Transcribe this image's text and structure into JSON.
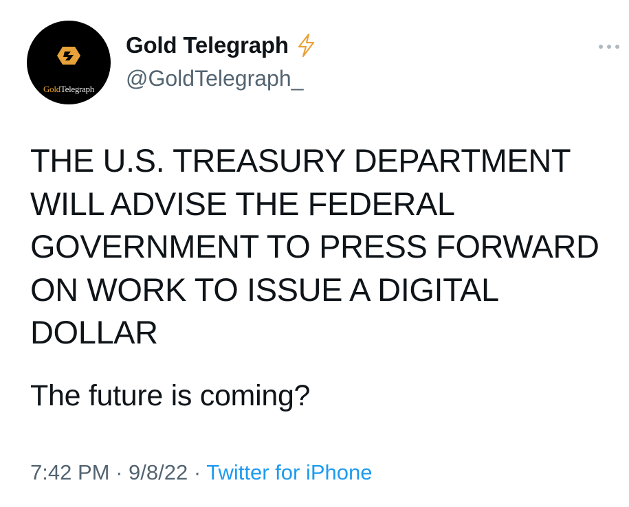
{
  "author": {
    "display_name": "Gold Telegraph",
    "handle": "@GoldTelegraph_",
    "avatar_text_gold": "Gold",
    "avatar_text_light": "Telegraph",
    "verified_icon": "lightning-bolt-icon"
  },
  "tweet": {
    "body": "THE U.S. TREASURY DEPARTMENT WILL ADVISE THE FEDERAL GOVERNMENT TO PRESS FORWARD ON WORK TO ISSUE A DIGITAL DOLLAR",
    "comment": "The future is coming?",
    "time": "7:42 PM",
    "date": "9/8/22",
    "separator": "·",
    "source": "Twitter for iPhone"
  },
  "colors": {
    "text": "#0f1419",
    "secondary": "#536471",
    "link": "#1d9bf0",
    "brand_gold": "#e8a23a"
  },
  "icons": {
    "more": "more-options-icon"
  }
}
